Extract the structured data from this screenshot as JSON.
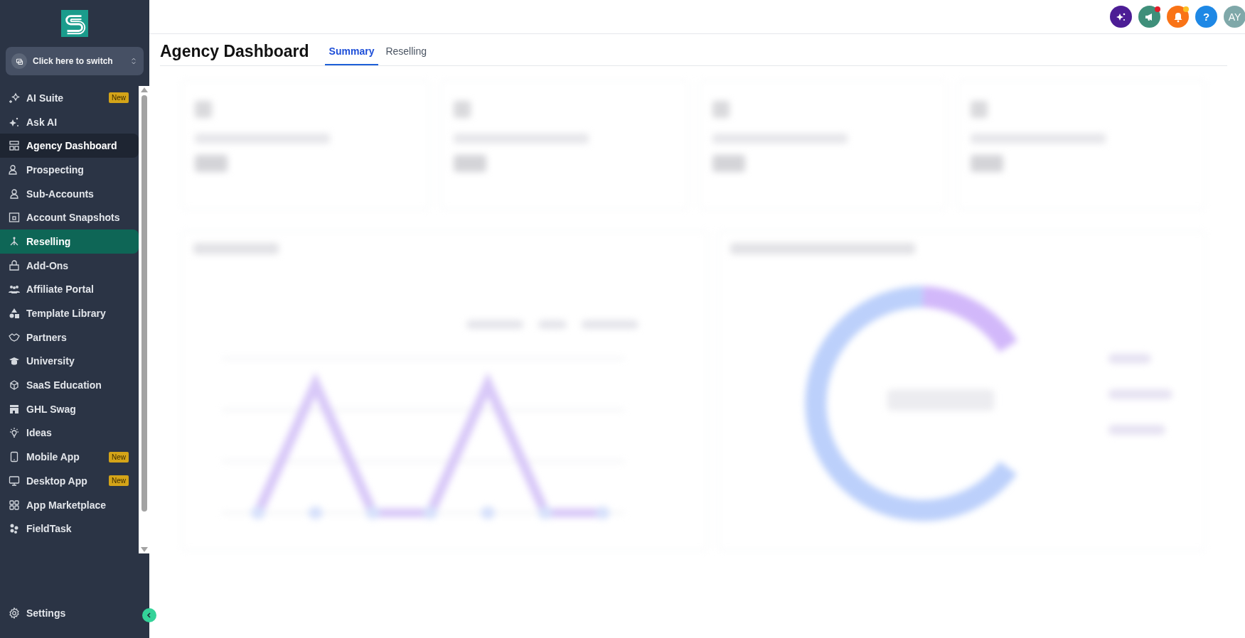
{
  "switcher": {
    "label": "Click here to switch"
  },
  "sidebar": {
    "items": [
      {
        "label": "AI Suite",
        "badge": "New",
        "selected": false,
        "highlighted": false
      },
      {
        "label": "Ask AI",
        "selected": false,
        "highlighted": false
      },
      {
        "label": "Agency Dashboard",
        "selected": false,
        "highlighted": true
      },
      {
        "label": "Prospecting",
        "selected": false,
        "highlighted": false
      },
      {
        "label": "Sub-Accounts",
        "selected": false,
        "highlighted": false
      },
      {
        "label": "Account Snapshots",
        "selected": false,
        "highlighted": false
      },
      {
        "label": "Reselling",
        "selected": true,
        "highlighted": false
      },
      {
        "label": "Add-Ons",
        "selected": false,
        "highlighted": false
      },
      {
        "label": "Affiliate Portal",
        "selected": false,
        "highlighted": false
      },
      {
        "label": "Template Library",
        "selected": false,
        "highlighted": false
      },
      {
        "label": "Partners",
        "selected": false,
        "highlighted": false
      },
      {
        "label": "University",
        "selected": false,
        "highlighted": false
      },
      {
        "label": "SaaS Education",
        "selected": false,
        "highlighted": false
      },
      {
        "label": "GHL Swag",
        "selected": false,
        "highlighted": false
      },
      {
        "label": "Ideas",
        "selected": false,
        "highlighted": false
      },
      {
        "label": "Mobile App",
        "badge": "New",
        "selected": false,
        "highlighted": false
      },
      {
        "label": "Desktop App",
        "badge": "New",
        "selected": false,
        "highlighted": false
      },
      {
        "label": "App Marketplace",
        "selected": false,
        "highlighted": false
      },
      {
        "label": "FieldTask",
        "selected": false,
        "highlighted": false
      }
    ],
    "settings": {
      "label": "Settings"
    }
  },
  "topbar": {
    "help": "?",
    "avatar": "AY"
  },
  "page": {
    "title": "Agency Dashboard",
    "tabs": [
      {
        "label": "Summary",
        "selected": true
      },
      {
        "label": "Reselling",
        "selected": false
      }
    ]
  }
}
